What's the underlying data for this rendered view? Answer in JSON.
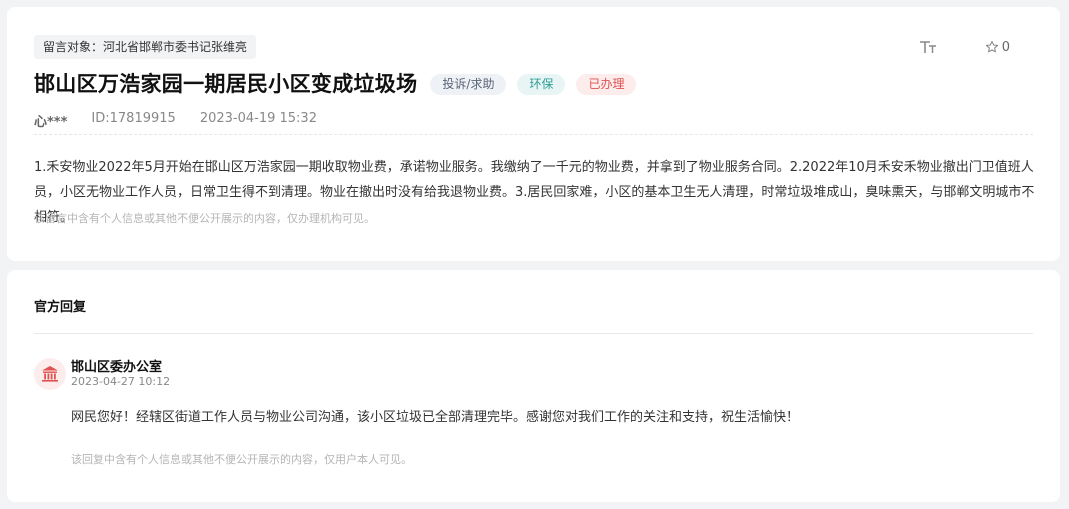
{
  "message": {
    "target_label": "留言对象：河北省邯郸市委书记张维亮",
    "title": "邯山区万浩家园一期居民小区变成垃圾场",
    "tags": {
      "type": "投诉/求助",
      "field": "环保",
      "status": "已办理"
    },
    "favorite_count": "0",
    "user": "心***",
    "id": "ID:17819915",
    "time": "2023-04-19 15:32",
    "content": "1.禾安物业2022年5月开始在邯山区万浩家园一期收取物业费，承诺物业服务。我缴纳了一千元的物业费，并拿到了物业服务合同。2.2022年10月禾安禾物业撤出门卫值班人员，小区无物业工作人员，日常卫生得不到清理。物业在撤出时没有给我退物业费。3.居民回家难，小区的基本卫生无人清理，时常垃圾堆成山，臭味熏天，与邯郸文明城市不相符。",
    "privacy_note": "该留言中含有个人信息或其他不便公开展示的内容，仅办理机构可见。"
  },
  "reply": {
    "section_title": "官方回复",
    "org_name": "邯山区委办公室",
    "time": "2023-04-27 10:12",
    "content": "网民您好！经辖区街道工作人员与物业公司沟通，该小区垃圾已全部清理完毕。感谢您对我们工作的关注和支持，祝生活愉快！",
    "privacy_note": "该回复中含有个人信息或其他不便公开展示的内容，仅用户本人可见。"
  },
  "icons": {
    "font_size": "font-size-icon",
    "favorite": "star-icon",
    "avatar": "government-building-icon"
  },
  "colors": {
    "status_red": "#e05252",
    "field_teal": "#2b9e95"
  }
}
